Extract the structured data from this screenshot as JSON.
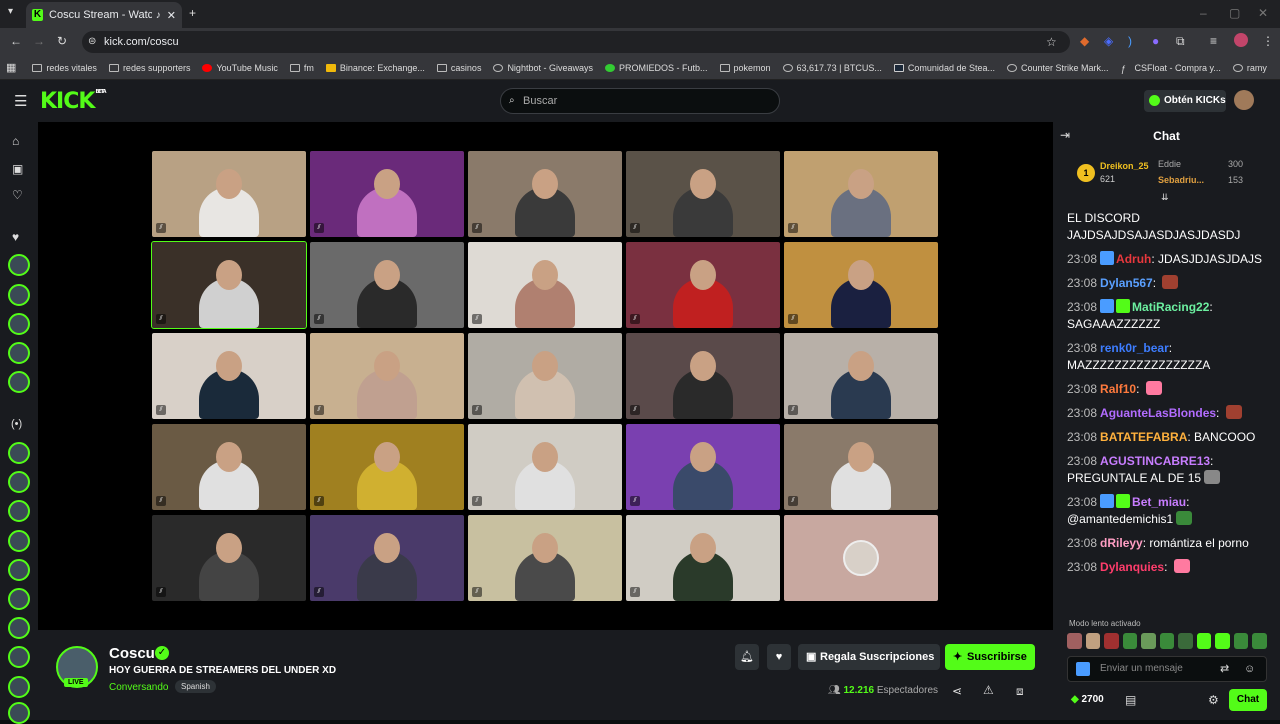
{
  "browser": {
    "tab_title": "Coscu Stream - Watch Live",
    "url": "kick.com/coscu",
    "bookmarks": [
      "redes vitales",
      "redes supporters",
      "YouTube Music",
      "fm",
      "Binance: Exchange...",
      "casinos",
      "Nightbot - Giveaways",
      "PROMIEDOS - Futb...",
      "pokemon",
      "63,617.73 | BTCUS...",
      "Comunidad de Stea...",
      "Counter Strike Mark...",
      "CSFloat - Compra y...",
      "ramy"
    ]
  },
  "header": {
    "logo": "KICK",
    "logo_sup": "BETA",
    "search_placeholder": "Buscar",
    "get_kicks": "Obtén KICKs"
  },
  "stream": {
    "channel": "Coscu",
    "live_badge": "LIVE",
    "title": "HOY GUERRA DE STREAMERS DEL UNDER XD",
    "category": "Conversando",
    "language": "Spanish",
    "gift_button": "Regala Suscripciones",
    "subscribe_button": "Suscribirse",
    "viewers_count": "12.216",
    "viewers_label": "Espectadores"
  },
  "chat": {
    "title": "Chat",
    "leaderboard": [
      {
        "rank": "1",
        "name": "Dreikon_25",
        "value": "621"
      },
      {
        "name": "Eddie",
        "value": "300"
      },
      {
        "name": "Sebadriu...",
        "value": "153"
      }
    ],
    "messages": [
      {
        "time": "",
        "user": "",
        "text": "EL DISCORD JAJDSAJDSAJASDJASJDASDJ",
        "color": "#ffffff"
      },
      {
        "time": "23:08",
        "user": "Adruh",
        "text": "JDASJDJASJDAJS",
        "color": "#e8383d"
      },
      {
        "time": "23:08",
        "user": "Dylan567",
        "text": "",
        "color": "#5aa0ff"
      },
      {
        "time": "23:08",
        "user": "MatiRacing22",
        "text": "SAGAAAZZZZZZ",
        "color": "#6cf0a0"
      },
      {
        "time": "23:08",
        "user": "renk0r_bear",
        "text": "MAZZZZZZZZZZZZZZZZA",
        "color": "#3d7dff"
      },
      {
        "time": "23:08",
        "user": "Ralf10",
        "text": "",
        "color": "#ff7a3d"
      },
      {
        "time": "23:08",
        "user": "AguanteLasBlondes",
        "text": "",
        "color": "#b26cff"
      },
      {
        "time": "23:08",
        "user": "BATATEFABRA",
        "text": "BANCOOO",
        "color": "#ffb13d"
      },
      {
        "time": "23:08",
        "user": "AGUSTINCABRE13",
        "text": "PREGUNTALE AL DE 15",
        "color": "#c87dff"
      },
      {
        "time": "23:08",
        "user": "Bet_miau",
        "text": "@amantedemichis1",
        "color": "#c87dff"
      },
      {
        "time": "23:08",
        "user": "dRileyy",
        "text": "romántiza el porno",
        "color": "#ff9ec4"
      },
      {
        "time": "23:08",
        "user": "Dylanquies",
        "text": "",
        "color": "#ff3d6c"
      }
    ],
    "slow_mode": "Modo lento activado",
    "input_placeholder": "Enviar un mensaje",
    "kicks_balance": "2700",
    "chat_button": "Chat"
  }
}
